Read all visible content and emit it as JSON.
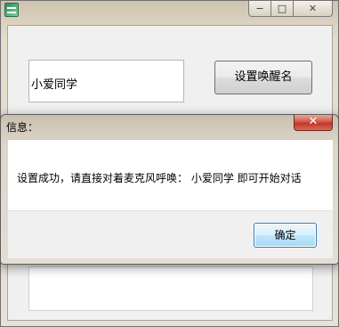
{
  "main_window": {
    "title": "",
    "wake_name_input": {
      "value": "小爱同学"
    },
    "set_wake_button_label": "设置唤醒名",
    "caption": {
      "minimize": "−",
      "maximize": "□",
      "close": "✕"
    }
  },
  "dialog": {
    "title": "信息：",
    "message": "设置成功，请直接对着麦克风呼唤： 小爱同学 即可开始对话",
    "ok_label": "确定",
    "close_glyph": "✕"
  },
  "icons": {
    "app": "app-icon",
    "minimize": "minimize-icon",
    "maximize": "maximize-icon",
    "close": "close-icon"
  },
  "colors": {
    "window_frame": "#e4dccd",
    "dialog_close": "#c1372b",
    "ok_button_border": "#3c7fb1"
  }
}
